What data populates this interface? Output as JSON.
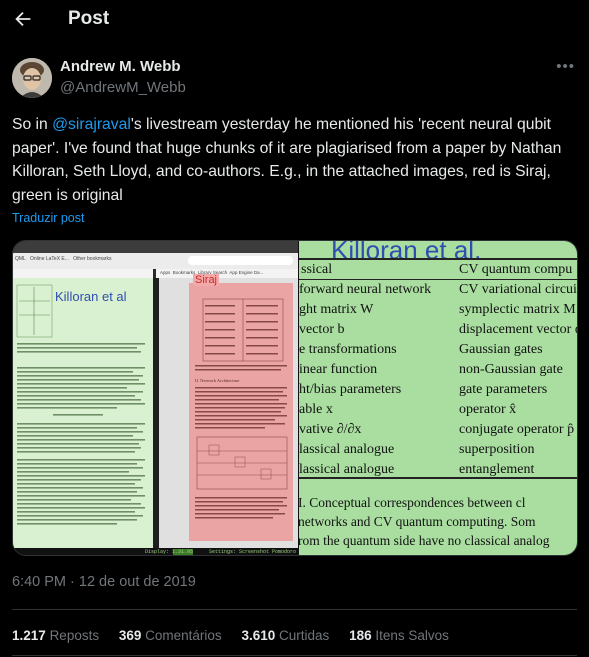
{
  "header": {
    "title": "Post",
    "back_icon": "arrow-left-icon"
  },
  "author": {
    "name": "Andrew M. Webb",
    "handle": "@AndrewM_Webb",
    "more_icon": "more-horizontal-icon"
  },
  "tweet": {
    "text_before": "So in ",
    "mention": "@sirajraval",
    "text_after": "'s livestream yesterday he mentioned his 'recent neural qubit paper'. I've found that huge chunks of it are plagiarised from a paper by Nathan Killoran, Seth Lloyd, and co-authors. E.g., in the attached images, red is Siraj, green is original",
    "translate": "Traduzir post"
  },
  "media": {
    "left": {
      "tabs": [
        "QML",
        "Online LaTeX E...",
        "Siraj",
        "Other bookmarks"
      ],
      "bookmarks": [
        "Apps",
        "Bookmarks",
        "Library Search",
        "App Engine Da..."
      ],
      "green_label": "Killoran et al",
      "red_label": "Siraj",
      "section_title": "II. Network Architecture",
      "status_display": "Display: 1.31.95",
      "status_settings": "Settings: Screenshot   Pomodoro (1)"
    },
    "right": {
      "title": "Killoran et al.",
      "col_left_header": "ssical",
      "col_right_header": "CV quantum compu",
      "rows": [
        [
          "forward neural network",
          "CV variational circui"
        ],
        [
          "ght matrix W",
          "symplectic matrix M"
        ],
        [
          "vector b",
          "displacement vector α"
        ],
        [
          "e transformations",
          "Gaussian gates"
        ],
        [
          "inear function",
          "non-Gaussian gate"
        ],
        [
          "ht/bias parameters",
          "gate parameters"
        ],
        [
          "able x",
          "operator x̂"
        ],
        [
          "vative ∂/∂x",
          "conjugate operator p̂"
        ],
        [
          "lassical analogue",
          "superposition"
        ],
        [
          "lassical analogue",
          "entanglement"
        ]
      ],
      "caption": [
        "I. Conceptual correspondences between cl",
        "networks and CV quantum computing. Som",
        "rom the quantum side have no classical analog"
      ]
    }
  },
  "timestamp": "6:40 PM · 12 de out de 2019",
  "stats": {
    "reposts_count": "1.217",
    "reposts_label": "Reposts",
    "comments_count": "369",
    "comments_label": "Comentários",
    "likes_count": "3.610",
    "likes_label": "Curtidas",
    "saves_count": "186",
    "saves_label": "Itens Salvos"
  },
  "colors": {
    "accent": "#1d9bf0",
    "original_green": "#a9dea0",
    "siraj_red": "#e48686"
  }
}
